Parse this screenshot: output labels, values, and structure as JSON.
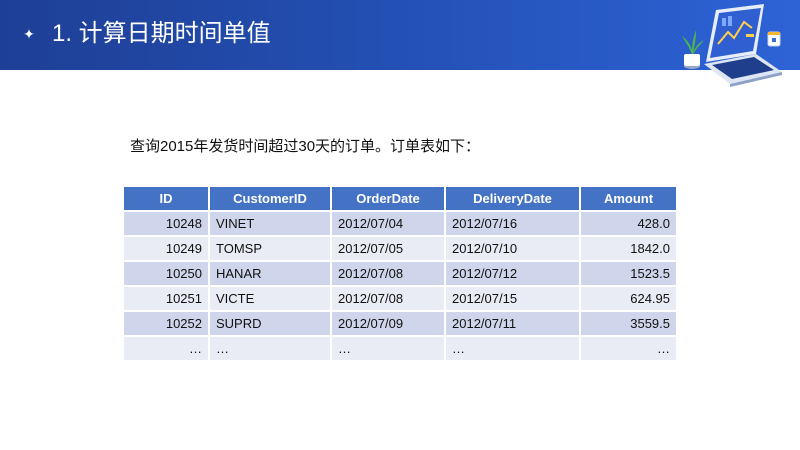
{
  "header": {
    "bullet_icon": "sparkle-icon",
    "title": "1. 计算日期时间单值",
    "illustration_icon": "laptop-chart-illustration"
  },
  "intro_text": "查询2015年发货时间超过30天的订单。订单表如下：",
  "table": {
    "headers": [
      "ID",
      "CustomerID",
      "OrderDate",
      "DeliveryDate",
      "Amount"
    ],
    "rows": [
      [
        "10248",
        "VINET",
        "2012/07/04",
        "2012/07/16",
        "428.0"
      ],
      [
        "10249",
        "TOMSP",
        "2012/07/05",
        "2012/07/10",
        "1842.0"
      ],
      [
        "10250",
        "HANAR",
        "2012/07/08",
        "2012/07/12",
        "1523.5"
      ],
      [
        "10251",
        "VICTE",
        "2012/07/08",
        "2012/07/15",
        "624.95"
      ],
      [
        "10252",
        "SUPRD",
        "2012/07/09",
        "2012/07/11",
        "3559.5"
      ],
      [
        "…",
        "…",
        "…",
        "…",
        "…"
      ]
    ]
  },
  "colors": {
    "header_bar": "#2452b8",
    "table_header": "#4472c4",
    "row_dark": "#cfd5ea",
    "row_light": "#e9ebf5"
  }
}
